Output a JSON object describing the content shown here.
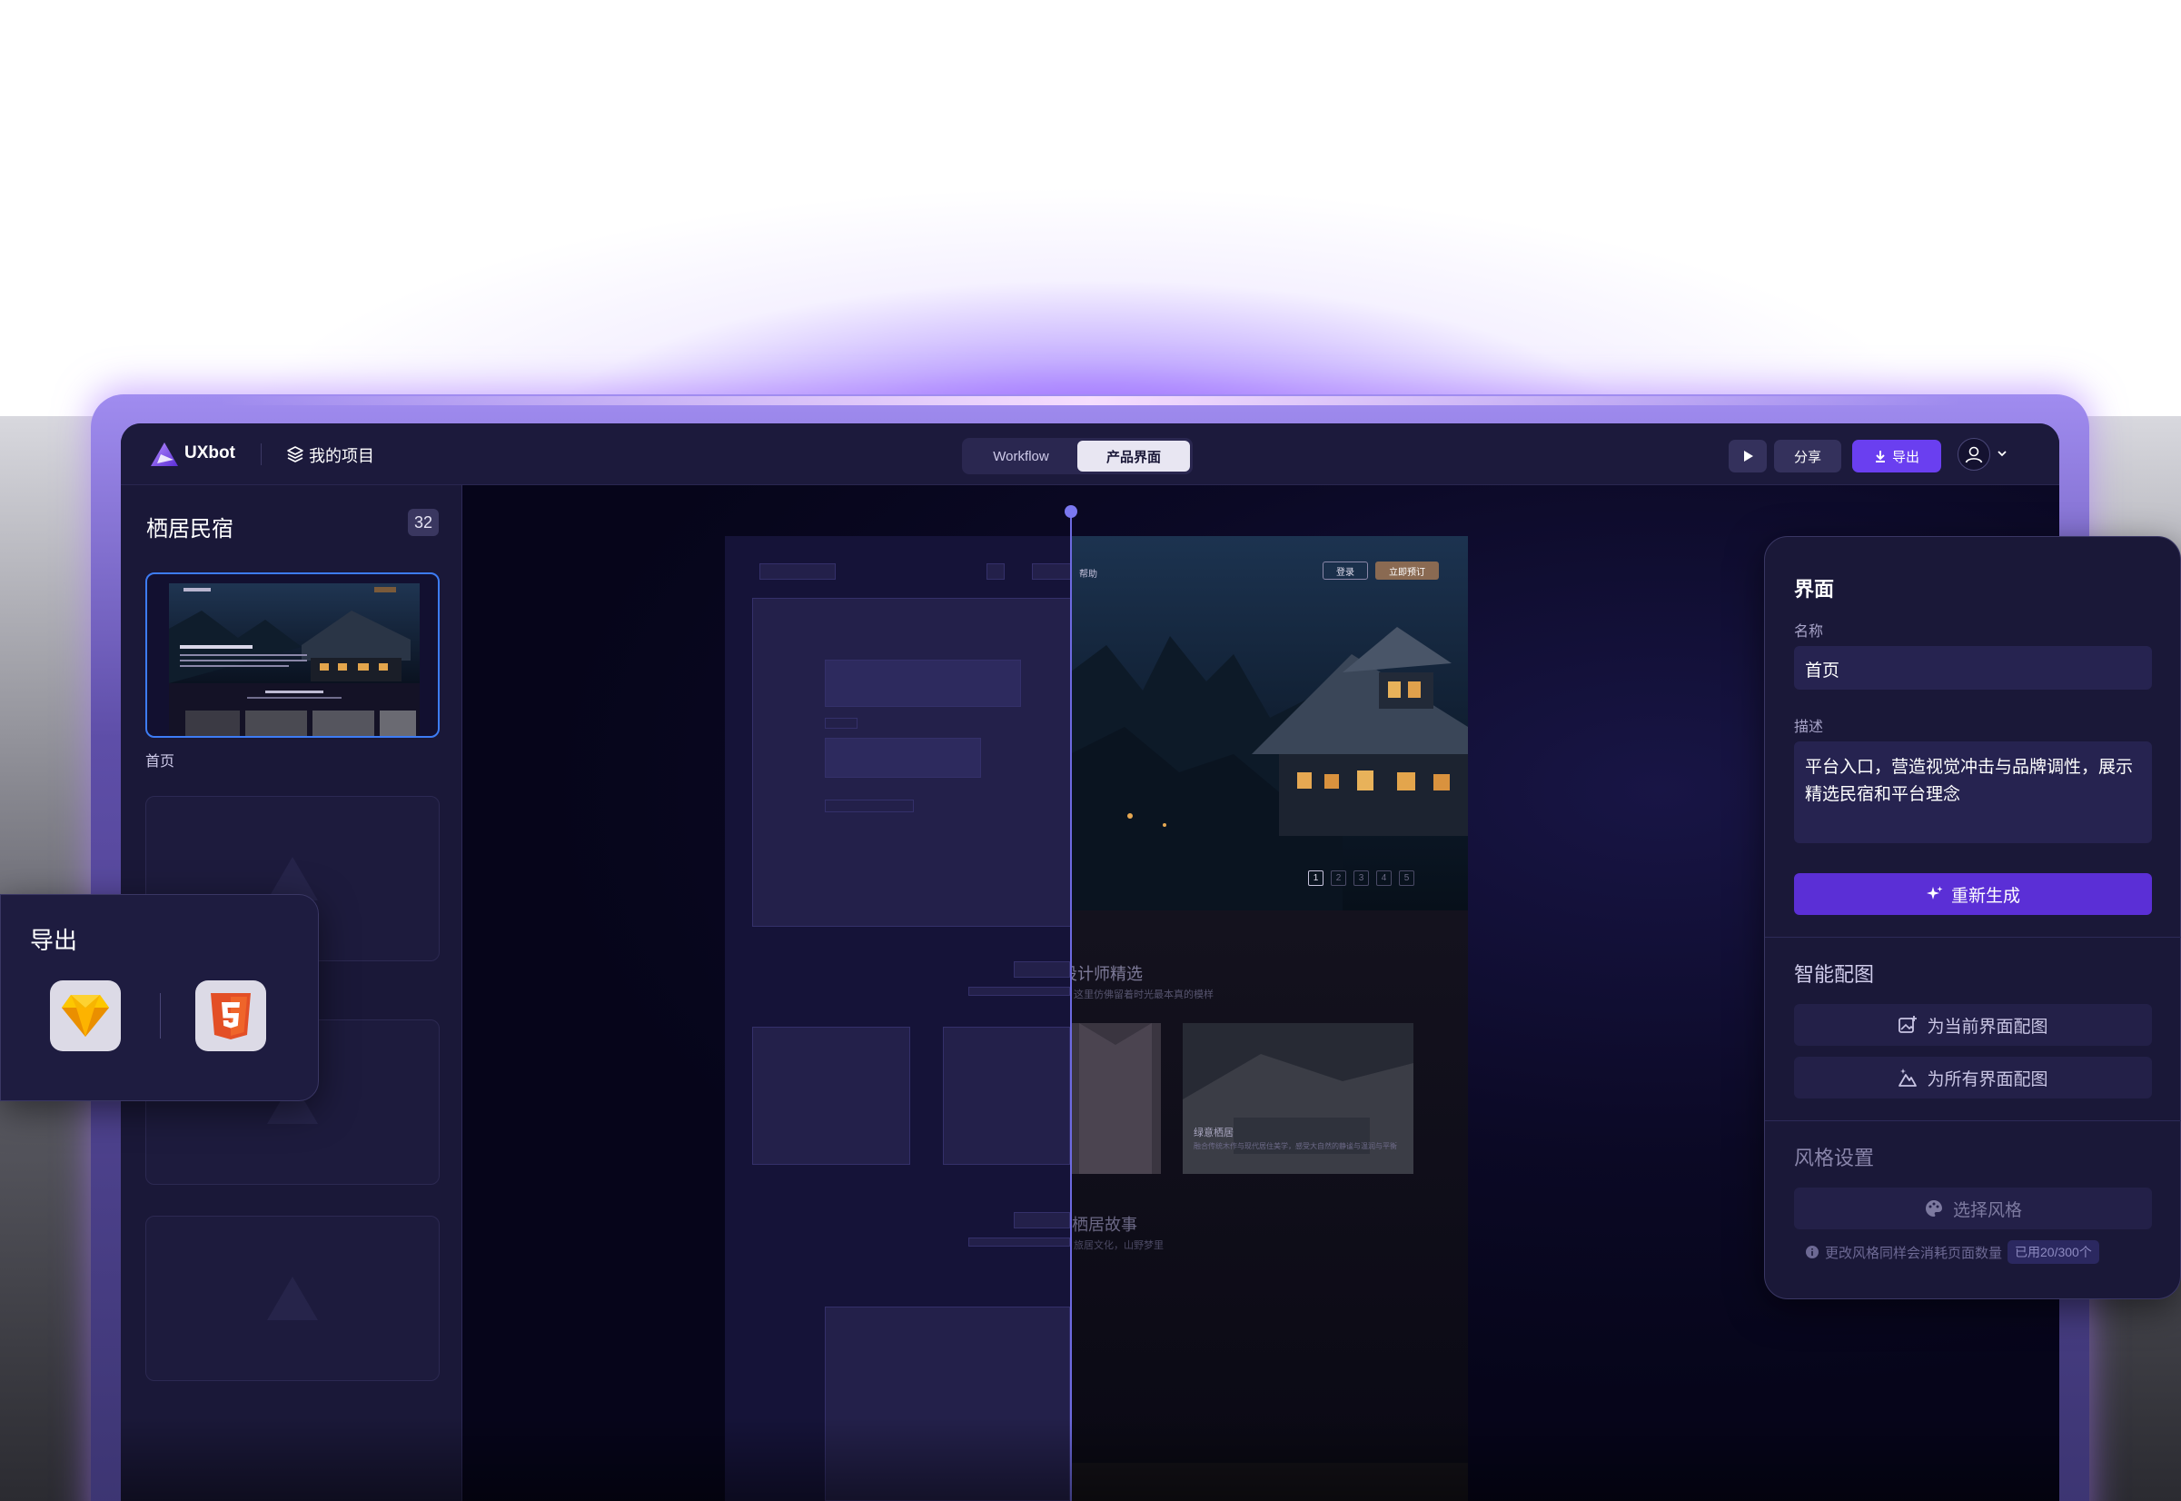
{
  "brand": {
    "name": "UXbot"
  },
  "topbar": {
    "project_link": "我的项目",
    "tabs": [
      {
        "label": "Workflow"
      },
      {
        "label": "产品界面"
      }
    ],
    "share_label": "分享",
    "export_label": "导出"
  },
  "sidebar": {
    "project_name": "栖居民宿",
    "page_count": "32",
    "pages": [
      {
        "label": "首页"
      }
    ],
    "thumb_text": {
      "headline": "栖云山居 · 隐于林间",
      "section": "设计师精选"
    }
  },
  "canvas": {
    "nav_help": "帮助",
    "login": "登录",
    "book_now": "立即预订",
    "pagination": [
      "1",
      "2",
      "3",
      "4",
      "5"
    ],
    "section1_title": "设计师精选",
    "section1_sub": "这里仿佛留着时光最本真的模样",
    "card_caption": "绿意栖居",
    "card_caption_sub": "融合传统木作与现代居住美学，感受大自然的静谧与温润与平衡",
    "section2_title": "栖居故事",
    "section2_sub": "旅居文化，山野梦里"
  },
  "panel": {
    "heading": "界面",
    "name_label": "名称",
    "name_value": "首页",
    "desc_label": "描述",
    "desc_value": "平台入口，营造视觉冲击与品牌调性，展示精选民宿和平台理念",
    "regenerate": "重新生成",
    "smart_images": "智能配图",
    "image_current": "为当前界面配图",
    "image_all": "为所有界面配图",
    "style_heading": "风格设置",
    "choose_style": "选择风格",
    "note": "更改风格同样会消耗页面数量",
    "quota": "已用20/300个"
  },
  "export_popover": {
    "title": "导出",
    "options": [
      "sketch-icon",
      "html5-icon"
    ]
  },
  "colors": {
    "accent": "#6a3ff0",
    "regen": "#5b2fd6",
    "selection": "#3d7cf5",
    "background": "#0d0a2a"
  }
}
